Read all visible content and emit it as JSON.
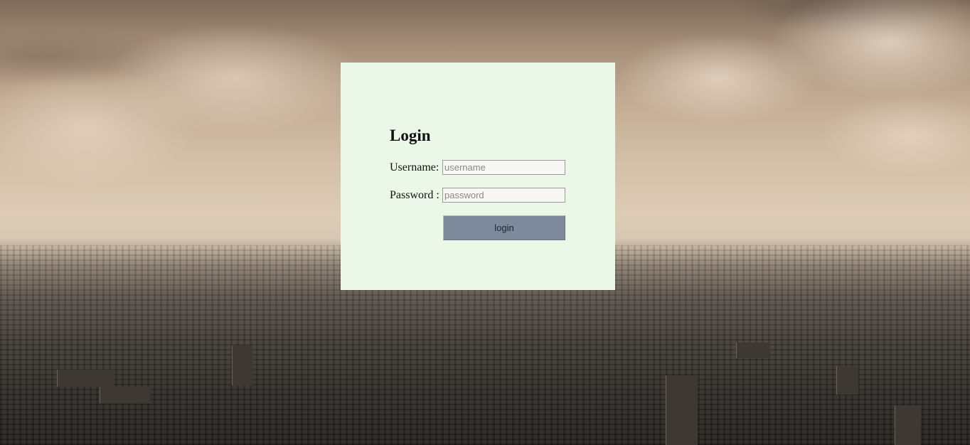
{
  "login": {
    "title": "Login",
    "username_label": "Username:",
    "username_placeholder": "username",
    "username_value": "",
    "password_label": "Password :",
    "password_placeholder": "password",
    "password_value": "",
    "submit_label": "login"
  },
  "colors": {
    "panel_background": "#ebf8e8",
    "button_background": "#7d8a9c",
    "title_text": "#111111"
  }
}
